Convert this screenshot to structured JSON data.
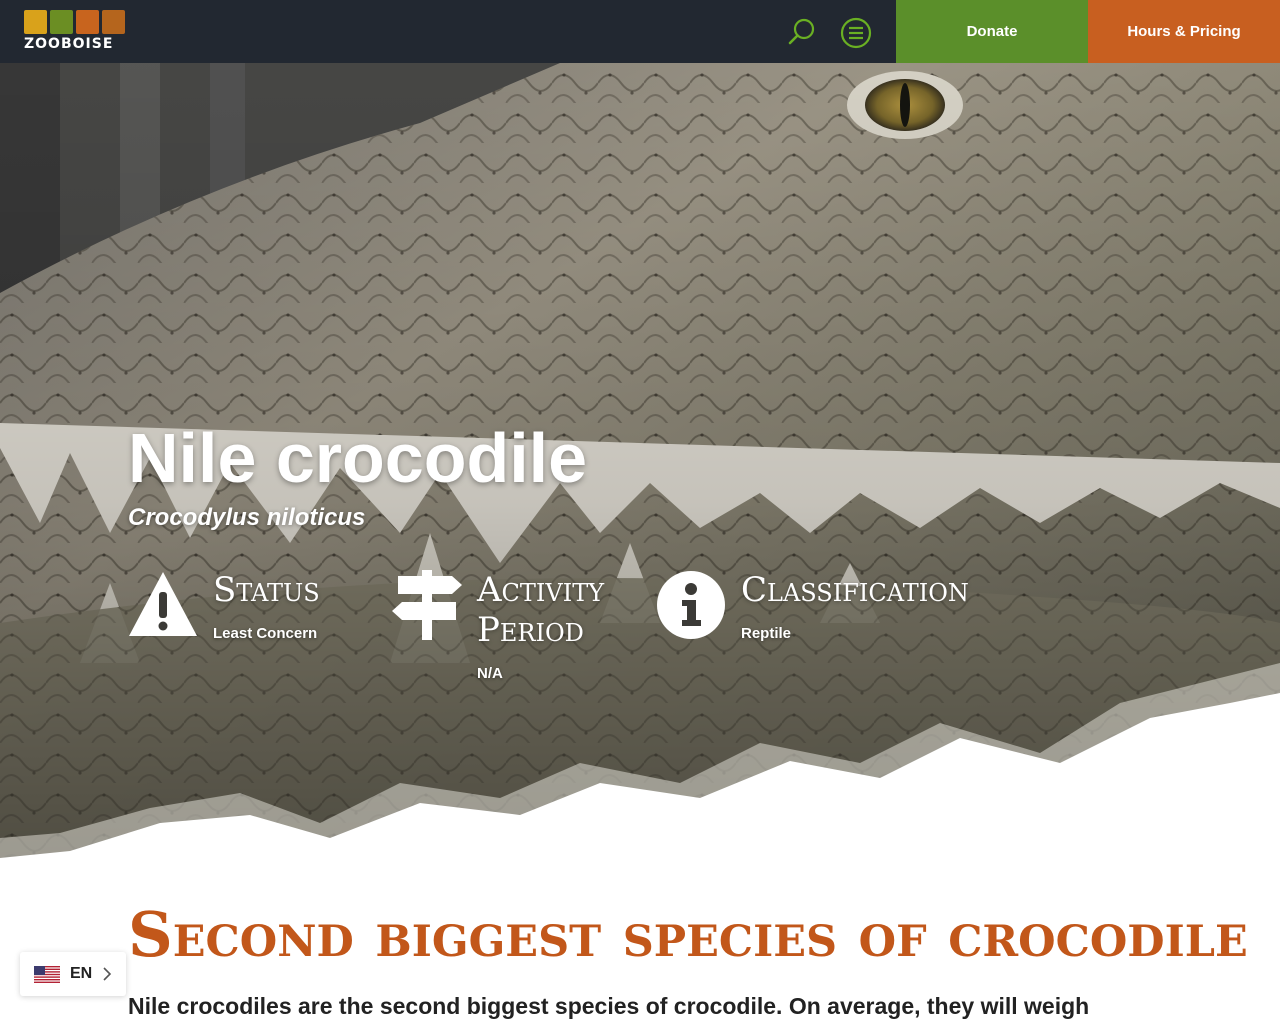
{
  "header": {
    "logo_text": "ZOOBOISE",
    "donate_label": "Donate",
    "hours_label": "Hours & Pricing",
    "icons": {
      "search": "search-icon",
      "menu": "menu-icon"
    },
    "colors": {
      "bar": "#222831",
      "donate": "#5b8f2a",
      "hours": "#c85f20",
      "icon_accent": "#6ab023"
    }
  },
  "hero": {
    "title": "Nile crocodile",
    "scientific_name": "Crocodylus niloticus",
    "facts": [
      {
        "heading": "Status",
        "value": "Least Concern",
        "icon": "warning-icon"
      },
      {
        "heading": "Activity Period",
        "value": "N/A",
        "icon": "signpost-icon"
      },
      {
        "heading": "Classification",
        "value": "Reptile",
        "icon": "info-icon"
      }
    ]
  },
  "section": {
    "title": "Second biggest species of crocodile",
    "text": "Nile crocodiles are the second biggest species of crocodile. On average, they will weigh",
    "title_color": "#c2571a"
  },
  "language": {
    "code": "EN",
    "flag": "us-flag-icon"
  }
}
